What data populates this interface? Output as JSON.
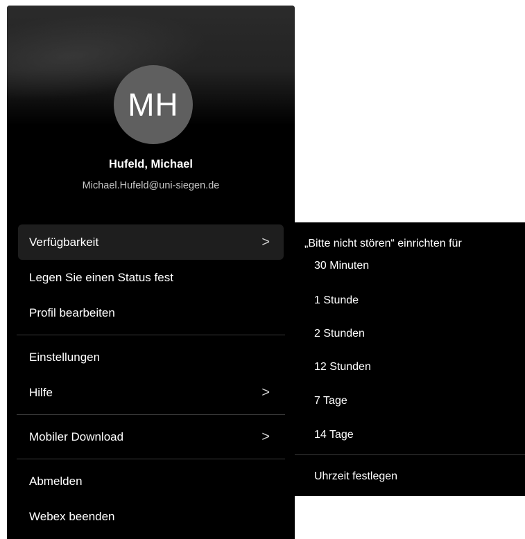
{
  "profile": {
    "initials": "MH",
    "name": "Hufeld, Michael",
    "email": "Michael.Hufeld@uni-siegen.de"
  },
  "menu": {
    "availability": "Verfügbarkeit",
    "set_status": "Legen Sie einen Status fest",
    "edit_profile": "Profil bearbeiten",
    "settings": "Einstellungen",
    "help": "Hilfe",
    "mobile_download": "Mobiler Download",
    "sign_out": "Abmelden",
    "quit": "Webex beenden",
    "chevron": ">"
  },
  "submenu": {
    "header": "„Bitte nicht stören“ einrichten für",
    "options": [
      "30 Minuten",
      "1 Stunde",
      "2 Stunden",
      "12 Stunden",
      "7 Tage",
      "14 Tage"
    ],
    "set_time": "Uhrzeit festlegen"
  },
  "colors": {
    "menu_background": "#000000",
    "highlight": "#1e1e1e",
    "avatar": "#5f5f5f",
    "separator": "#3c3c3c"
  }
}
